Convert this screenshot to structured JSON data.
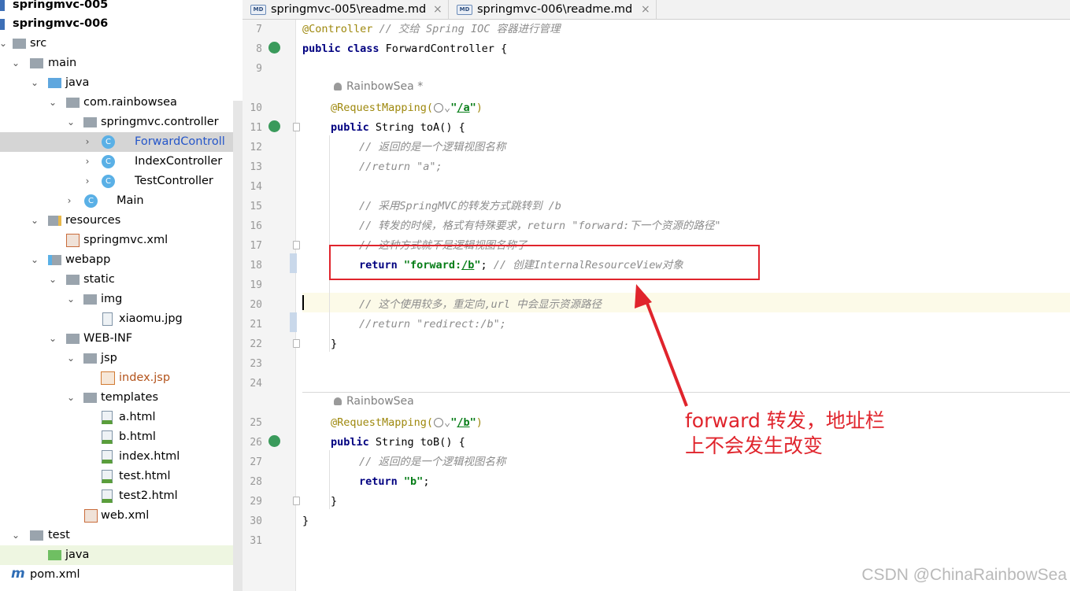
{
  "tree": {
    "rows": [
      {
        "label": "springmvc-005",
        "icon": "module-icon"
      },
      {
        "label": "springmvc-006",
        "icon": "module-icon"
      },
      {
        "label": "src",
        "icon": "folder-icon"
      },
      {
        "label": "main",
        "icon": "folder-icon"
      },
      {
        "label": "java",
        "icon": "source-folder-icon"
      },
      {
        "label": "com.rainbowsea",
        "icon": "package-icon"
      },
      {
        "label": "springmvc.controller",
        "icon": "package-icon"
      },
      {
        "label": "ForwardControll",
        "icon": "class-icon"
      },
      {
        "label": "IndexController",
        "icon": "class-icon"
      },
      {
        "label": "TestController",
        "icon": "class-icon"
      },
      {
        "label": "Main",
        "icon": "main-class-icon"
      },
      {
        "label": "resources",
        "icon": "resources-folder-icon"
      },
      {
        "label": "springmvc.xml",
        "icon": "xml-file-icon"
      },
      {
        "label": "webapp",
        "icon": "web-folder-icon"
      },
      {
        "label": "static",
        "icon": "folder-icon"
      },
      {
        "label": "img",
        "icon": "folder-icon"
      },
      {
        "label": "xiaomu.jpg",
        "icon": "image-file-icon"
      },
      {
        "label": "WEB-INF",
        "icon": "folder-icon"
      },
      {
        "label": "jsp",
        "icon": "folder-icon"
      },
      {
        "label": "index.jsp",
        "icon": "jsp-file-icon"
      },
      {
        "label": "templates",
        "icon": "folder-icon"
      },
      {
        "label": "a.html",
        "icon": "html-file-icon"
      },
      {
        "label": "b.html",
        "icon": "html-file-icon"
      },
      {
        "label": "index.html",
        "icon": "html-file-icon"
      },
      {
        "label": "test.html",
        "icon": "html-file-icon"
      },
      {
        "label": "test2.html",
        "icon": "html-file-icon"
      },
      {
        "label": "web.xml",
        "icon": "xml-file-icon"
      },
      {
        "label": "test",
        "icon": "folder-icon"
      },
      {
        "label": "java",
        "icon": "test-source-folder-icon"
      },
      {
        "label": "pom.xml",
        "icon": "maven-icon"
      }
    ]
  },
  "tabs": [
    {
      "label": "springmvc-005\\readme.md",
      "icon": "md-file-icon",
      "icon_text": "MD",
      "close": "×"
    },
    {
      "label": "springmvc-006\\readme.md",
      "icon": "md-file-icon",
      "icon_text": "MD",
      "close": "×"
    }
  ],
  "gutter": {
    "line_numbers": [
      "7",
      "8",
      "9",
      "",
      "10",
      "11",
      "12",
      "13",
      "14",
      "15",
      "16",
      "17",
      "18",
      "19",
      "20",
      "21",
      "22",
      "23",
      "24",
      "",
      "25",
      "26",
      "27",
      "28",
      "29",
      "30",
      "31"
    ]
  },
  "code": {
    "l7_ann": "@Controller",
    "l7_cm": " // 交给 Spring IOC 容器进行管理",
    "l8_kw": "public class",
    "l8_rest": " ForwardController {",
    "author1": "RainbowSea *",
    "l10_ann": "@RequestMapping(",
    "l10_chev": "⌄",
    "l10_str_open": "\"",
    "l10_path": "/a",
    "l10_str_close": "\"",
    "l10_end": ")",
    "l11_kw": "public",
    "l11_rest": " String toA() {",
    "l12_cm": "// 返回的是一个逻辑视图名称",
    "l13_cm": "//return \"a\";",
    "l15_cm": "// 采用SpringMVC的转发方式跳转到 /b",
    "l16_cm": "// 转发的时候，格式有特殊要求，return \"forward:下一个资源的路径\"",
    "l17_cm": "// 这种方式就不是逻辑视图名称了",
    "l18_kw": "return",
    "l18_str_open": "\"forward:",
    "l18_path": "/b",
    "l18_str_close": "\"",
    "l18_semi": ";",
    "l18_cm": " // 创建InternalResourceView对象",
    "l20_cm": "// 这个使用较多，重定向,url 中会显示资源路径",
    "l21_cm": "//return \"redirect:/b\";",
    "l22": "}",
    "author2": "RainbowSea",
    "l25_ann": "@RequestMapping(",
    "l25_chev": "⌄",
    "l25_str_open": "\"",
    "l25_path": "/b",
    "l25_str_close": "\"",
    "l25_end": ")",
    "l26_kw": "public",
    "l26_rest": " String toB() {",
    "l27_cm": "// 返回的是一个逻辑视图名称",
    "l28_kw": "return",
    "l28_str": "\"b\"",
    "l28_semi": ";",
    "l29": "}",
    "l30": "}"
  },
  "annotation": {
    "note": "forward 转发，地址栏\n上不会发生改变",
    "color": "#e0242c"
  },
  "watermark": "CSDN @ChinaRainbowSea"
}
